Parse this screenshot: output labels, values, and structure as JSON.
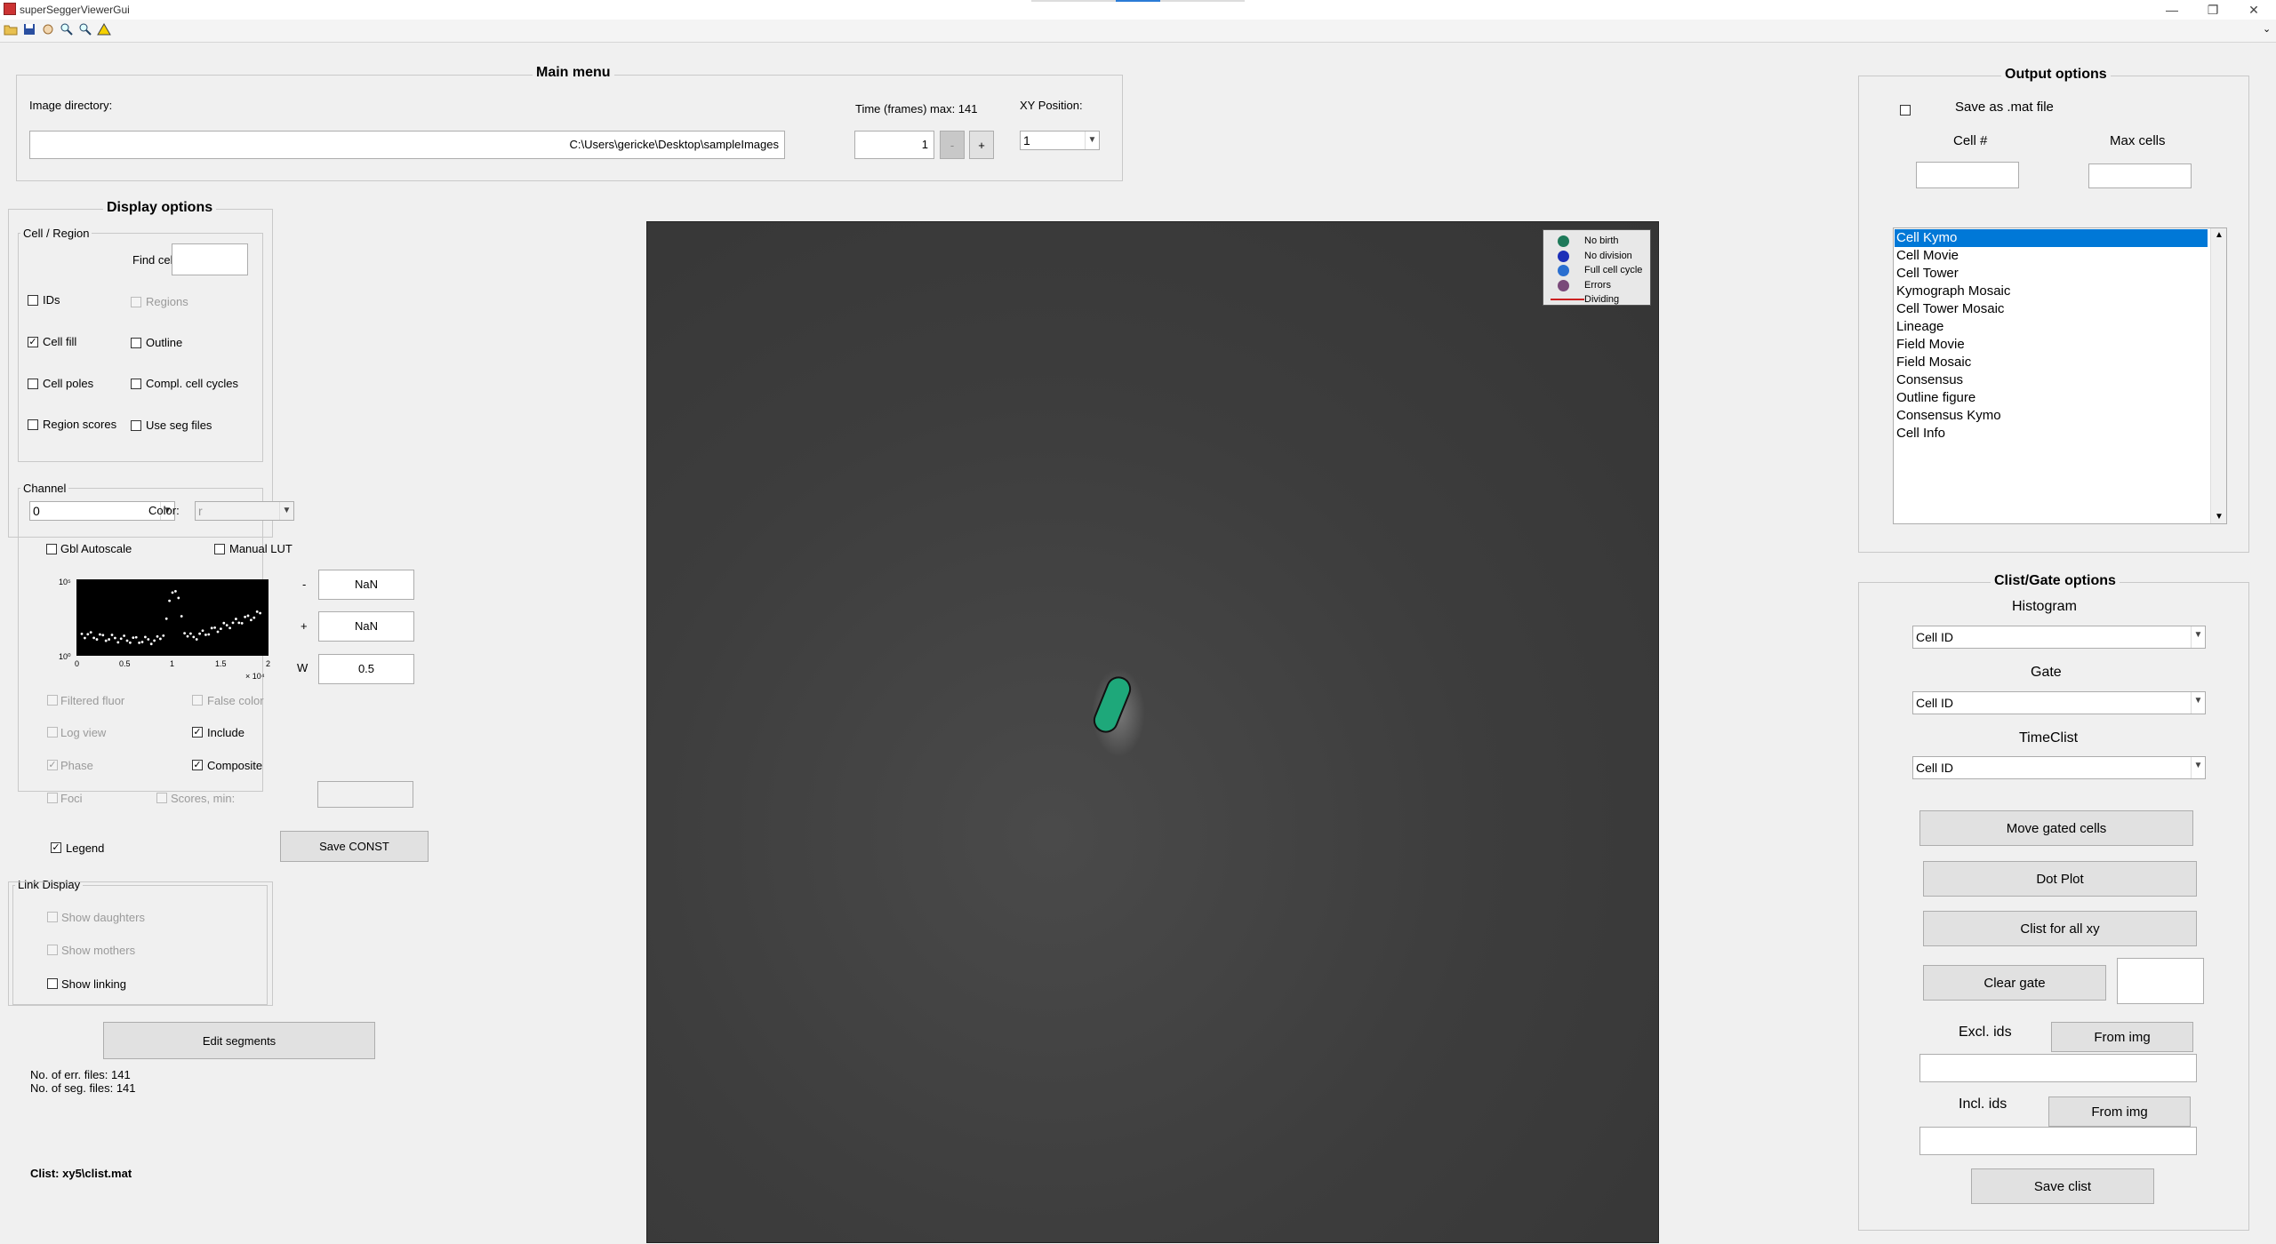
{
  "window": {
    "title": "superSeggerViewerGui",
    "minimize_glyph": "—",
    "restore_glyph": "❐",
    "close_glyph": "✕"
  },
  "toolbar": {
    "icons": [
      "open-icon",
      "save-icon",
      "pan-icon",
      "zoom-in-icon",
      "zoom-out-icon",
      "warning-icon"
    ]
  },
  "main_menu": {
    "title": "Main menu",
    "image_dir_label": "Image directory:",
    "image_dir_value": "C:\\Users\\gericke\\Desktop\\sampleImages",
    "time_label": "Time (frames) max: 141",
    "time_value": "1",
    "prev_label": "-",
    "next_label": "+",
    "xy_label": "XY Position:",
    "xy_value": "1"
  },
  "display_options": {
    "title": "Display options",
    "cell_region": {
      "title": "Cell / Region",
      "find_cell_label": "Find cell:",
      "ids_label": "IDs",
      "regions_label": "Regions",
      "cell_fill_label": "Cell fill",
      "outline_label": "Outline",
      "cell_poles_label": "Cell poles",
      "compl_cycles_label": "Compl. cell cycles",
      "region_scores_label": "Region scores",
      "use_seg_label": "Use seg files"
    },
    "channel": {
      "title": "Channel",
      "channel_value": "0",
      "color_label": "Color:",
      "color_value": "r",
      "gbl_autoscale_label": "Gbl Autoscale",
      "manual_lut_label": "Manual LUT",
      "minus_label": "-",
      "plus_label": "+",
      "w_label": "W",
      "min_value": "NaN",
      "max_value": "NaN",
      "w_value": "0.5",
      "hist_ytop": "10⁵",
      "hist_ybottom": "10⁰",
      "hist_xticks": [
        "0",
        "0.5",
        "1",
        "1.5",
        "2"
      ],
      "hist_xexp": "× 10⁴",
      "filtered_fluor_label": "Filtered fluor",
      "false_color_label": "False color",
      "log_view_label": "Log view",
      "include_label": "Include",
      "phase_label": "Phase",
      "composite_label": "Composite",
      "foci_label": "Foci",
      "scores_min_label": "Scores, min:"
    },
    "legend_label": "Legend",
    "save_const_label": "Save CONST"
  },
  "link_display": {
    "title": "Link Display",
    "show_daughters_label": "Show daughters",
    "show_mothers_label": "Show mothers",
    "show_linking_label": "Show linking"
  },
  "edit_segments_label": "Edit segments",
  "status": {
    "err_files": "No. of err. files: 141",
    "seg_files": "No. of seg. files: 141",
    "clist": "Clist: xy5\\clist.mat"
  },
  "image_legend": {
    "items": [
      {
        "label": "No birth",
        "color": "#1f7a5a"
      },
      {
        "label": "No division",
        "color": "#1c2fb8"
      },
      {
        "label": "Full cell cycle",
        "color": "#2a6fd0"
      },
      {
        "label": "Errors",
        "color": "#7a4a7a"
      },
      {
        "label": "Dividing",
        "color": "#cc2222"
      }
    ]
  },
  "output_options": {
    "title": "Output options",
    "save_mat_label": "Save as .mat file",
    "cell_num_label": "Cell #",
    "max_cells_label": "Max cells",
    "list_items": [
      "Cell Kymo",
      "Cell Movie",
      "Cell Tower",
      "Kymograph Mosaic",
      "Cell Tower Mosaic",
      "Lineage",
      "Field Movie",
      "Field Mosaic",
      "Consensus",
      "Outline figure",
      "Consensus Kymo",
      "Cell Info"
    ],
    "selected_index": 0
  },
  "clist_gate": {
    "title": "Clist/Gate options",
    "histogram_label": "Histogram",
    "histogram_value": "Cell ID",
    "gate_label": "Gate",
    "gate_value": "Cell ID",
    "timeclist_label": "TimeClist",
    "timeclist_value": "Cell ID",
    "move_gated_label": "Move gated cells",
    "dot_plot_label": "Dot Plot",
    "clist_all_xy_label": "Clist for all xy",
    "clear_gate_label": "Clear gate",
    "excl_ids_label": "Excl. ids",
    "incl_ids_label": "Incl. ids",
    "from_img_label": "From img",
    "save_clist_label": "Save clist"
  },
  "colors": {
    "cell_fill": "#1ea87a",
    "selection": "#0078d7"
  }
}
